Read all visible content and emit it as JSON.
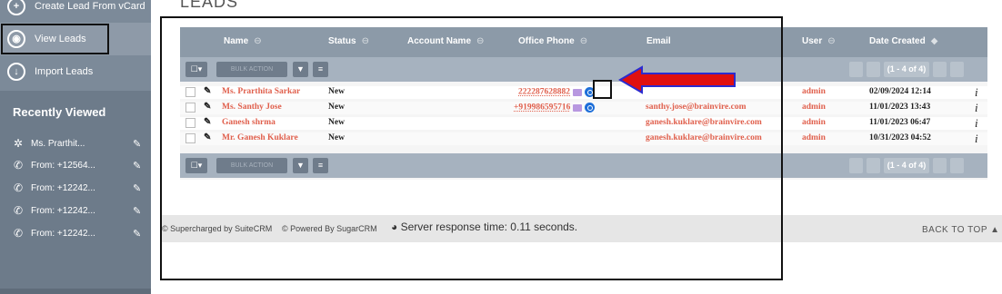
{
  "sidebar": {
    "items": [
      {
        "label": "Create Lead From vCard",
        "icon": "plus-box-icon"
      },
      {
        "label": "View Leads",
        "icon": "eye-icon"
      },
      {
        "label": "Import Leads",
        "icon": "download-icon"
      }
    ],
    "recent_title": "Recently Viewed",
    "recent": [
      {
        "label": "Ms. Prarthit...",
        "icon": "gear-icon"
      },
      {
        "label": "From: +12564...",
        "icon": "phone-icon"
      },
      {
        "label": "From: +12242...",
        "icon": "phone-icon"
      },
      {
        "label": "From: +12242...",
        "icon": "phone-icon"
      },
      {
        "label": "From: +12242...",
        "icon": "phone-icon"
      }
    ]
  },
  "page": {
    "title": "LEADS"
  },
  "table": {
    "columns": [
      "Name",
      "Status",
      "Account Name",
      "Office Phone",
      "Email",
      "User",
      "Date Created"
    ],
    "bulk_action": "BULK ACTION",
    "pagination": "(1 - 4 of 4)",
    "rows": [
      {
        "name": "Ms. Prarthita Sarkar",
        "status": "New",
        "account": "",
        "phone": "222287628882",
        "email": "",
        "user": "admin",
        "date": "02/09/2024 12:14"
      },
      {
        "name": "Ms. Santhy Jose",
        "status": "New",
        "account": "",
        "phone": "+919986595716",
        "email": "santhy.jose@brainvire.com",
        "user": "admin",
        "date": "11/01/2023 13:43"
      },
      {
        "name": "Ganesh shrma",
        "status": "New",
        "account": "",
        "phone": "",
        "email": "ganesh.kuklare@brainvire.com",
        "user": "admin",
        "date": "11/01/2023 06:47"
      },
      {
        "name": "Mr. Ganesh Kuklare",
        "status": "New",
        "account": "",
        "phone": "",
        "email": "ganesh.kuklare@brainvire.com",
        "user": "admin",
        "date": "10/31/2023 04:52"
      }
    ]
  },
  "footer": {
    "supercharged": "© Supercharged by SuiteCRM",
    "powered": "© Powered By SugarCRM",
    "server": "Server response time: 0.11 seconds.",
    "back_to_top": "BACK TO TOP ▲"
  },
  "colors": {
    "accent_link": "#e0604d",
    "header": "#8c9aa8",
    "sidebar": "#7c8a99",
    "annotation_arrow": "#e01010"
  }
}
